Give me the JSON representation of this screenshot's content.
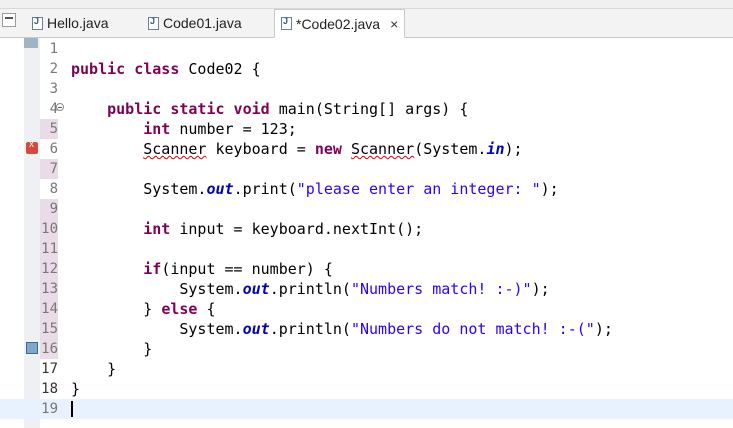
{
  "tabs": [
    {
      "label": "Hello.java",
      "active": false
    },
    {
      "label": "Code01.java",
      "active": false
    },
    {
      "label": "*Code02.java",
      "active": true,
      "close": "×"
    }
  ],
  "editor": {
    "current_line": 19,
    "lines": [
      {
        "n": "1",
        "code": ""
      },
      {
        "n": "2",
        "code": "<span class='kw'>public class</span> Code02 {"
      },
      {
        "n": "3",
        "code": ""
      },
      {
        "n": "4",
        "code": "    <span class='kw'>public static void</span> main(String[] args) {"
      },
      {
        "n": "5",
        "code": "        <span class='kw'>int</span> number = 123;"
      },
      {
        "n": "6",
        "code": "        <span class='err'>Scanner</span> keyboard = <span class='kw'>new</span> <span class='err'>Scanner</span>(System.<span class='fld'>in</span>);"
      },
      {
        "n": "7",
        "code": ""
      },
      {
        "n": "8",
        "code": "        System.<span class='fld'>out</span>.print(<span class='str'>\"please enter an integer: \"</span>);"
      },
      {
        "n": "9",
        "code": ""
      },
      {
        "n": "10",
        "code": "        <span class='kw'>int</span> input = keyboard.nextInt();"
      },
      {
        "n": "11",
        "code": ""
      },
      {
        "n": "12",
        "code": "        <span class='kw'>if</span>(input == number) {"
      },
      {
        "n": "13",
        "code": "            System.<span class='fld'>out</span>.println(<span class='str'>\"Numbers match! :-)\"</span>);"
      },
      {
        "n": "14",
        "code": "        } <span class='kw'>else</span> {"
      },
      {
        "n": "15",
        "code": "            System.<span class='fld'>out</span>.println(<span class='str'>\"Numbers do not match! :-(\"</span>);"
      },
      {
        "n": "16",
        "code": "        }"
      },
      {
        "n": "17",
        "code": "    }"
      },
      {
        "n": "18",
        "code": "}"
      },
      {
        "n": "19",
        "code": ""
      }
    ]
  }
}
